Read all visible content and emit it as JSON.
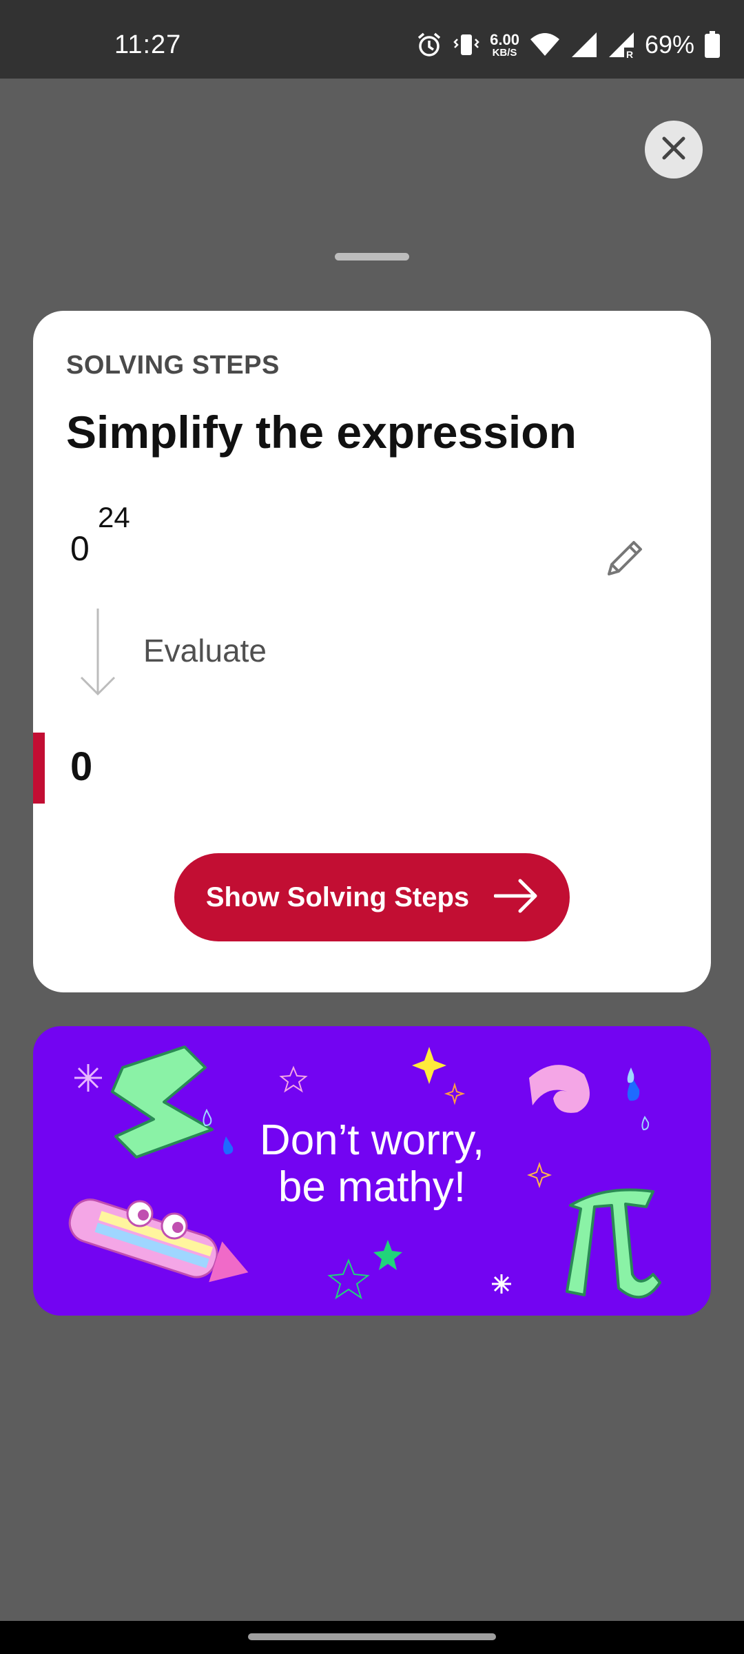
{
  "status_bar": {
    "time": "11:27",
    "net_speed_value": "6.00",
    "net_speed_unit": "KB/S",
    "battery": "69%",
    "icons": [
      "alarm-icon",
      "vibrate-icon",
      "wifi-icon",
      "signal-icon",
      "signal-roaming-icon",
      "battery-icon"
    ]
  },
  "sheet": {
    "close_icon": "close-icon"
  },
  "card": {
    "eyebrow": "SOLVING STEPS",
    "title": "Simplify the expression",
    "expression": {
      "base": "0",
      "exponent": "24"
    },
    "edit_icon": "pencil-icon",
    "step": {
      "label": "Evaluate",
      "icon": "arrow-down-icon"
    },
    "result": "0",
    "cta_label": "Show Solving Steps",
    "cta_icon": "arrow-right-icon"
  },
  "banner": {
    "line1": "Don’t worry,",
    "line2": "be mathy!"
  },
  "colors": {
    "accent": "#c20e33",
    "banner_bg": "#7304f2",
    "scrim": "#5d5d5d"
  }
}
